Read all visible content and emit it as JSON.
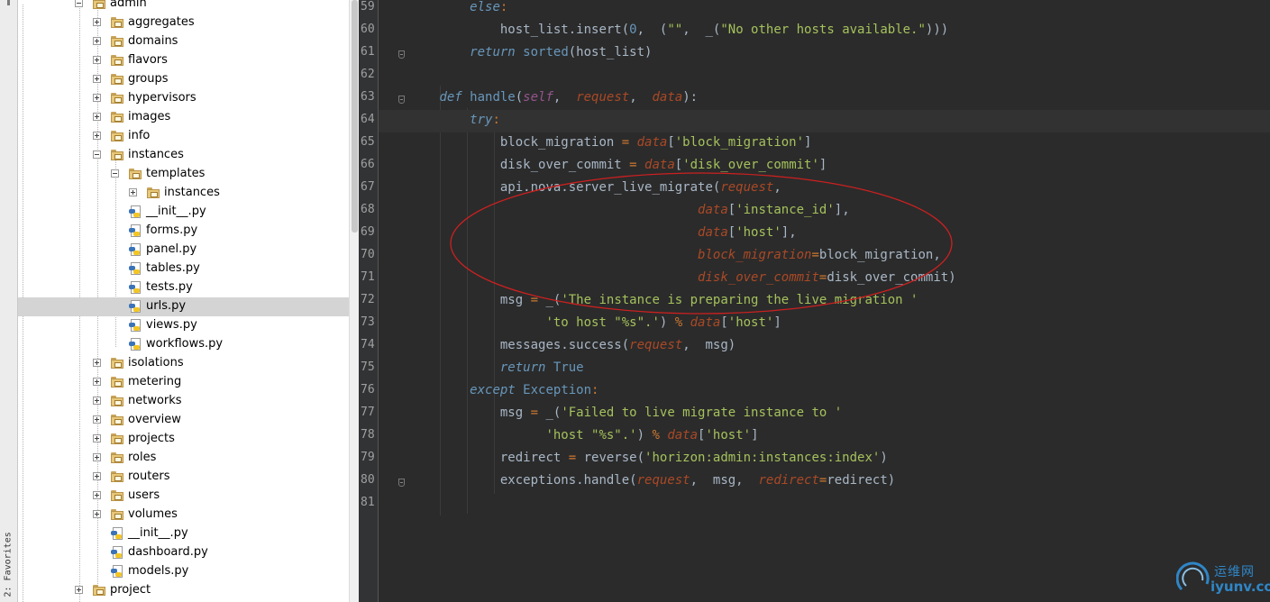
{
  "sidebar_tab": {
    "label": "2: Favorites"
  },
  "tree": {
    "rows": [
      {
        "name": "admin",
        "kind": "folder",
        "expander": "minus",
        "level": 1
      },
      {
        "name": "aggregates",
        "kind": "folder",
        "expander": "plus",
        "level": 2
      },
      {
        "name": "domains",
        "kind": "folder",
        "expander": "plus",
        "level": 2
      },
      {
        "name": "flavors",
        "kind": "folder",
        "expander": "plus",
        "level": 2
      },
      {
        "name": "groups",
        "kind": "folder",
        "expander": "plus",
        "level": 2
      },
      {
        "name": "hypervisors",
        "kind": "folder",
        "expander": "plus",
        "level": 2
      },
      {
        "name": "images",
        "kind": "folder",
        "expander": "plus",
        "level": 2
      },
      {
        "name": "info",
        "kind": "folder",
        "expander": "plus",
        "level": 2
      },
      {
        "name": "instances",
        "kind": "folder",
        "expander": "minus",
        "level": 2
      },
      {
        "name": "templates",
        "kind": "folder",
        "expander": "minus",
        "level": 3
      },
      {
        "name": "instances",
        "kind": "folder",
        "expander": "plus",
        "level": 4
      },
      {
        "name": "__init__.py",
        "kind": "py",
        "expander": "",
        "level": 3
      },
      {
        "name": "forms.py",
        "kind": "py",
        "expander": "",
        "level": 3
      },
      {
        "name": "panel.py",
        "kind": "py",
        "expander": "",
        "level": 3
      },
      {
        "name": "tables.py",
        "kind": "py",
        "expander": "",
        "level": 3
      },
      {
        "name": "tests.py",
        "kind": "py",
        "expander": "",
        "level": 3
      },
      {
        "name": "urls.py",
        "kind": "py",
        "expander": "",
        "level": 3,
        "selected": true
      },
      {
        "name": "views.py",
        "kind": "py",
        "expander": "",
        "level": 3
      },
      {
        "name": "workflows.py",
        "kind": "py",
        "expander": "",
        "level": 3
      },
      {
        "name": "isolations",
        "kind": "folder",
        "expander": "plus",
        "level": 2
      },
      {
        "name": "metering",
        "kind": "folder",
        "expander": "plus",
        "level": 2
      },
      {
        "name": "networks",
        "kind": "folder",
        "expander": "plus",
        "level": 2
      },
      {
        "name": "overview",
        "kind": "folder",
        "expander": "plus",
        "level": 2
      },
      {
        "name": "projects",
        "kind": "folder",
        "expander": "plus",
        "level": 2
      },
      {
        "name": "roles",
        "kind": "folder",
        "expander": "plus",
        "level": 2
      },
      {
        "name": "routers",
        "kind": "folder",
        "expander": "plus",
        "level": 2
      },
      {
        "name": "users",
        "kind": "folder",
        "expander": "plus",
        "level": 2
      },
      {
        "name": "volumes",
        "kind": "folder",
        "expander": "plus",
        "level": 2
      },
      {
        "name": "__init__.py",
        "kind": "py",
        "expander": "",
        "level": 2
      },
      {
        "name": "dashboard.py",
        "kind": "py",
        "expander": "",
        "level": 2
      },
      {
        "name": "models.py",
        "kind": "py",
        "expander": "",
        "level": 2
      },
      {
        "name": "project",
        "kind": "folder",
        "expander": "plus",
        "level": 1
      }
    ]
  },
  "editor": {
    "current_line": "64",
    "lines": [
      {
        "no": "59",
        "indent": 3,
        "tokens": [
          [
            "kwi",
            "else"
          ],
          [
            "kw",
            ":"
          ]
        ]
      },
      {
        "no": "60",
        "indent": 4,
        "tokens": [
          [
            "fn",
            "host_list.insert("
          ],
          [
            "num",
            "0"
          ],
          [
            "fn",
            ",  ("
          ],
          [
            "str",
            "\"\""
          ],
          [
            "fn",
            ",  _("
          ],
          [
            "str",
            "\"No other hosts available.\""
          ],
          [
            "fn",
            ")))"
          ]
        ]
      },
      {
        "no": "61",
        "indent": 3,
        "tokens": [
          [
            "kwi",
            "return "
          ],
          [
            "blue",
            "sorted"
          ],
          [
            "fn",
            "(host_list)"
          ]
        ],
        "fold": true
      },
      {
        "no": "62",
        "indent": 0,
        "tokens": []
      },
      {
        "no": "63",
        "indent": 2,
        "tokens": [
          [
            "kwi",
            "def "
          ],
          [
            "blue",
            "handle"
          ],
          [
            "fn",
            "("
          ],
          [
            "self",
            "self"
          ],
          [
            "fn",
            ",  "
          ],
          [
            "param",
            "request"
          ],
          [
            "fn",
            ",  "
          ],
          [
            "param",
            "data"
          ],
          [
            "fn",
            "):"
          ]
        ],
        "fold": true
      },
      {
        "no": "64",
        "indent": 3,
        "tokens": [
          [
            "kwi",
            "try"
          ],
          [
            "kw",
            ":"
          ]
        ]
      },
      {
        "no": "65",
        "indent": 4,
        "tokens": [
          [
            "fn",
            "block_migration "
          ],
          [
            "kw",
            "= "
          ],
          [
            "param",
            "data"
          ],
          [
            "fn",
            "["
          ],
          [
            "str",
            "'block_migration'"
          ],
          [
            "fn",
            "]"
          ]
        ]
      },
      {
        "no": "66",
        "indent": 4,
        "tokens": [
          [
            "fn",
            "disk_over_commit "
          ],
          [
            "kw",
            "= "
          ],
          [
            "param",
            "data"
          ],
          [
            "fn",
            "["
          ],
          [
            "str",
            "'disk_over_commit'"
          ],
          [
            "fn",
            "]"
          ]
        ]
      },
      {
        "no": "67",
        "indent": 4,
        "tokens": [
          [
            "fn",
            "api.nova.server_live_migrate("
          ],
          [
            "param",
            "request"
          ],
          [
            "fn",
            ","
          ]
        ]
      },
      {
        "no": "68",
        "indent": 0,
        "pad": "                                          ",
        "tokens": [
          [
            "param",
            "data"
          ],
          [
            "fn",
            "["
          ],
          [
            "str",
            "'instance_id'"
          ],
          [
            "fn",
            "],"
          ]
        ]
      },
      {
        "no": "69",
        "indent": 0,
        "pad": "                                          ",
        "tokens": [
          [
            "param",
            "data"
          ],
          [
            "fn",
            "["
          ],
          [
            "str",
            "'host'"
          ],
          [
            "fn",
            "],"
          ]
        ]
      },
      {
        "no": "70",
        "indent": 0,
        "pad": "                                          ",
        "tokens": [
          [
            "param",
            "block_migration"
          ],
          [
            "kw",
            "="
          ],
          [
            "fn",
            "block_migration,"
          ]
        ]
      },
      {
        "no": "71",
        "indent": 0,
        "pad": "                                          ",
        "tokens": [
          [
            "param",
            "disk_over_commit"
          ],
          [
            "kw",
            "="
          ],
          [
            "fn",
            "disk_over_commit)"
          ]
        ]
      },
      {
        "no": "72",
        "indent": 4,
        "tokens": [
          [
            "fn",
            "msg "
          ],
          [
            "kw",
            "= "
          ],
          [
            "fn",
            "_("
          ],
          [
            "str",
            "'The instance is preparing the live migration '"
          ]
        ]
      },
      {
        "no": "73",
        "indent": 0,
        "pad": "                      ",
        "tokens": [
          [
            "str",
            "'to host \"%s\".'"
          ],
          [
            "fn",
            ") "
          ],
          [
            "kw",
            "% "
          ],
          [
            "param",
            "data"
          ],
          [
            "fn",
            "["
          ],
          [
            "str",
            "'host'"
          ],
          [
            "fn",
            "]"
          ]
        ]
      },
      {
        "no": "74",
        "indent": 4,
        "tokens": [
          [
            "fn",
            "messages.success("
          ],
          [
            "param",
            "request"
          ],
          [
            "fn",
            ",  msg)"
          ]
        ]
      },
      {
        "no": "75",
        "indent": 4,
        "tokens": [
          [
            "kwi",
            "return "
          ],
          [
            "blue",
            "True"
          ]
        ]
      },
      {
        "no": "76",
        "indent": 3,
        "tokens": [
          [
            "kwi",
            "except "
          ],
          [
            "blue",
            "Exception"
          ],
          [
            "kw",
            ":"
          ]
        ]
      },
      {
        "no": "77",
        "indent": 4,
        "tokens": [
          [
            "fn",
            "msg "
          ],
          [
            "kw",
            "= "
          ],
          [
            "fn",
            "_("
          ],
          [
            "str",
            "'Failed to live migrate instance to '"
          ]
        ]
      },
      {
        "no": "78",
        "indent": 0,
        "pad": "                      ",
        "tokens": [
          [
            "str",
            "'host \"%s\".'"
          ],
          [
            "fn",
            ") "
          ],
          [
            "kw",
            "% "
          ],
          [
            "param",
            "data"
          ],
          [
            "fn",
            "["
          ],
          [
            "str",
            "'host'"
          ],
          [
            "fn",
            "]"
          ]
        ]
      },
      {
        "no": "79",
        "indent": 4,
        "tokens": [
          [
            "fn",
            "redirect "
          ],
          [
            "kw",
            "= "
          ],
          [
            "fn",
            "reverse("
          ],
          [
            "str",
            "'horizon:admin:instances:index'"
          ],
          [
            "fn",
            ")"
          ]
        ]
      },
      {
        "no": "80",
        "indent": 4,
        "tokens": [
          [
            "fn",
            "exceptions.handle("
          ],
          [
            "param",
            "request"
          ],
          [
            "fn",
            ",  msg,  "
          ],
          [
            "param",
            "redirect"
          ],
          [
            "kw",
            "="
          ],
          [
            "fn",
            "redirect)"
          ]
        ],
        "fold": true
      },
      {
        "no": "81",
        "indent": 0,
        "tokens": []
      }
    ]
  },
  "watermark": {
    "cn": "运维网",
    "url": "iyunv.com"
  },
  "colors": {
    "annotation": "#cc2020",
    "selection": "#d4d4d4",
    "editor_bg": "#2b2b2b"
  }
}
